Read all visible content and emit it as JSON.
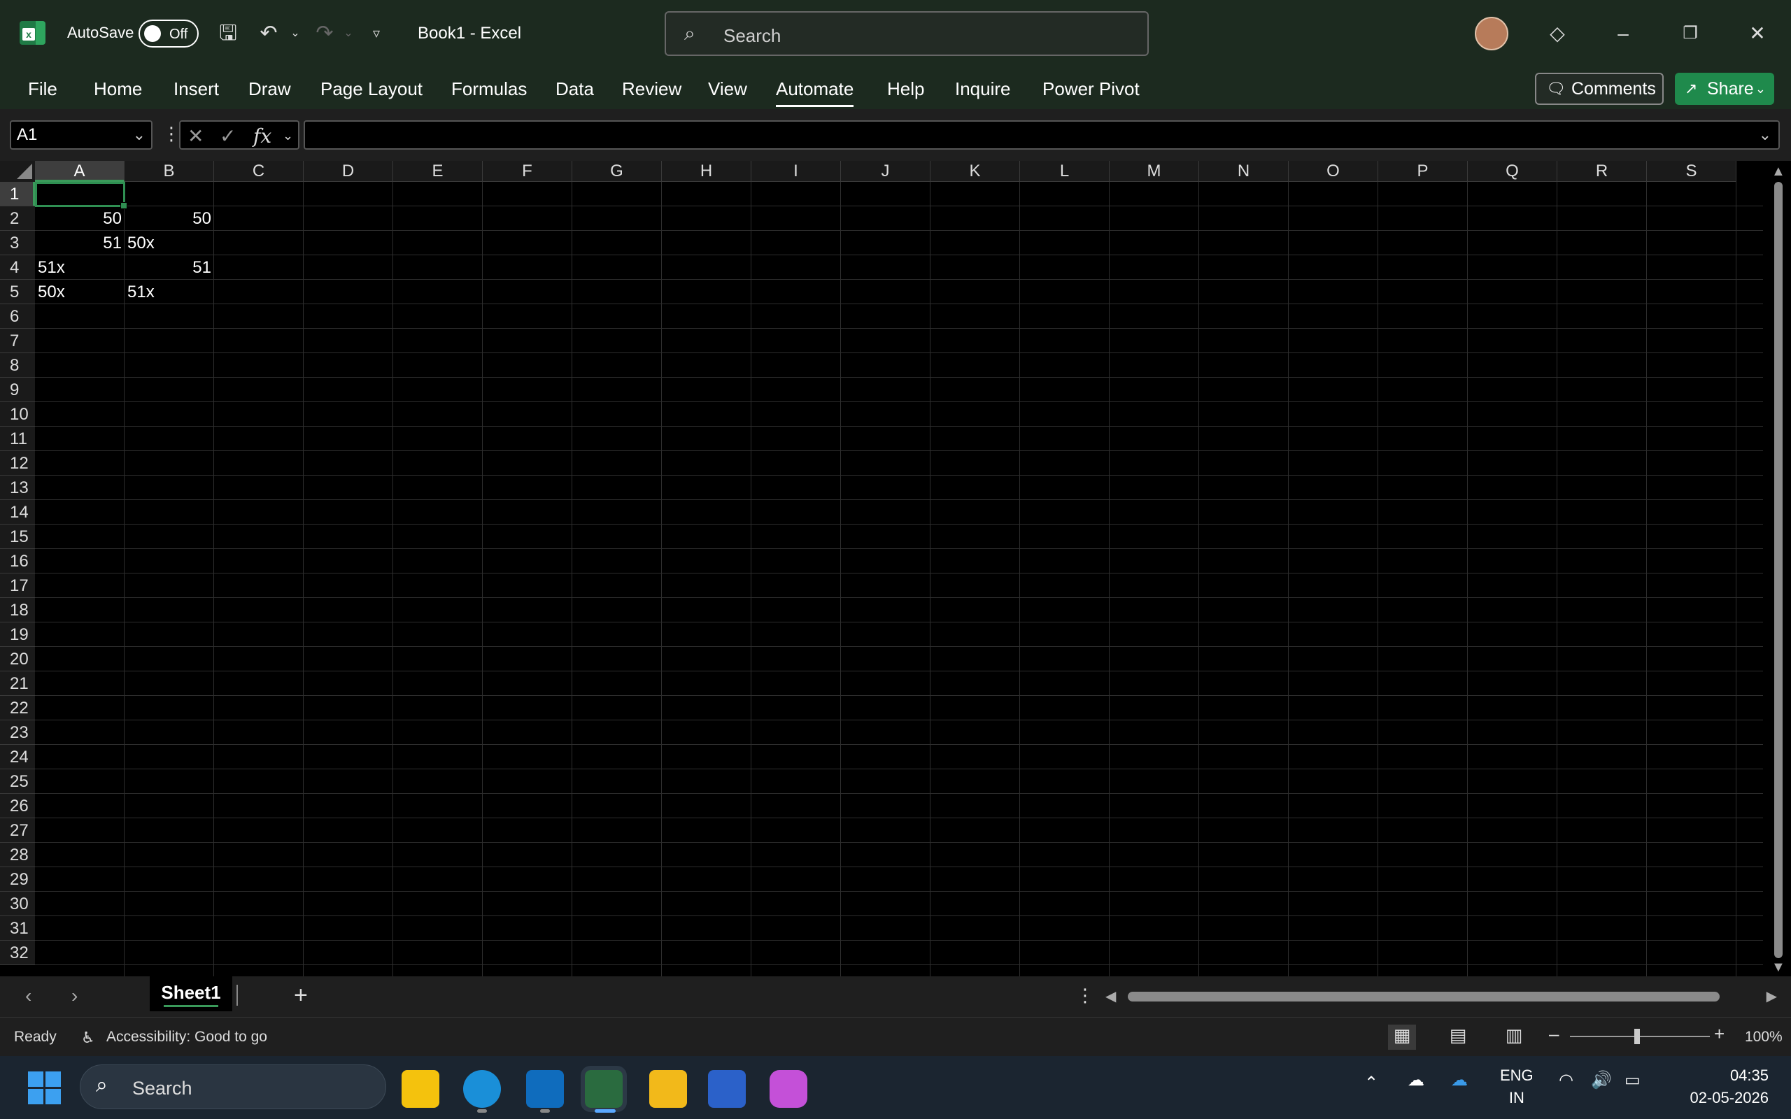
{
  "titlebar": {
    "autosave_label": "AutoSave",
    "autosave_state": "Off",
    "doc_title": "Book1  -  Excel",
    "search_placeholder": "Search"
  },
  "ribbon_tabs": [
    "File",
    "Home",
    "Insert",
    "Draw",
    "Page Layout",
    "Formulas",
    "Data",
    "Review",
    "View",
    "Automate",
    "Help",
    "Inquire",
    "Power Pivot"
  ],
  "active_tab": "Automate",
  "comments_label": "Comments",
  "share_label": "Share",
  "formula_bar": {
    "name_box": "A1",
    "fx": "fx",
    "formula": ""
  },
  "columns": [
    "A",
    "B",
    "C",
    "D",
    "E",
    "F",
    "G",
    "H",
    "I",
    "J",
    "K",
    "L",
    "M",
    "N",
    "O",
    "P",
    "Q",
    "R",
    "S"
  ],
  "rows": [
    "1",
    "2",
    "3",
    "4",
    "5",
    "6",
    "7",
    "8",
    "9",
    "10",
    "11",
    "12",
    "13",
    "14",
    "15",
    "16",
    "17",
    "18",
    "19",
    "20",
    "21",
    "22",
    "23",
    "24",
    "25",
    "26",
    "27",
    "28",
    "29",
    "30",
    "31",
    "32"
  ],
  "cells": [
    {
      "ref": "A2",
      "value": "50",
      "type": "num"
    },
    {
      "ref": "B2",
      "value": "50",
      "type": "num"
    },
    {
      "ref": "A3",
      "value": "51",
      "type": "num"
    },
    {
      "ref": "B3",
      "value": "50x",
      "type": "text"
    },
    {
      "ref": "A4",
      "value": "51x",
      "type": "text"
    },
    {
      "ref": "B4",
      "value": "51",
      "type": "num"
    },
    {
      "ref": "A5",
      "value": "50x",
      "type": "text"
    },
    {
      "ref": "B5",
      "value": "51x",
      "type": "text"
    }
  ],
  "sheets": [
    "Sheet1"
  ],
  "status": {
    "ready": "Ready",
    "accessibility": "Accessibility: Good to go",
    "zoom": "100%"
  },
  "taskbar": {
    "search_placeholder": "Search",
    "lang_top": "ENG",
    "lang_bottom": "IN",
    "time": "04:35",
    "date": "02-05-2026"
  },
  "colors": {
    "accent_green": "#2f8f52",
    "share_green": "#1f8a4c",
    "titlebar_bg": "#1c2a1f"
  }
}
